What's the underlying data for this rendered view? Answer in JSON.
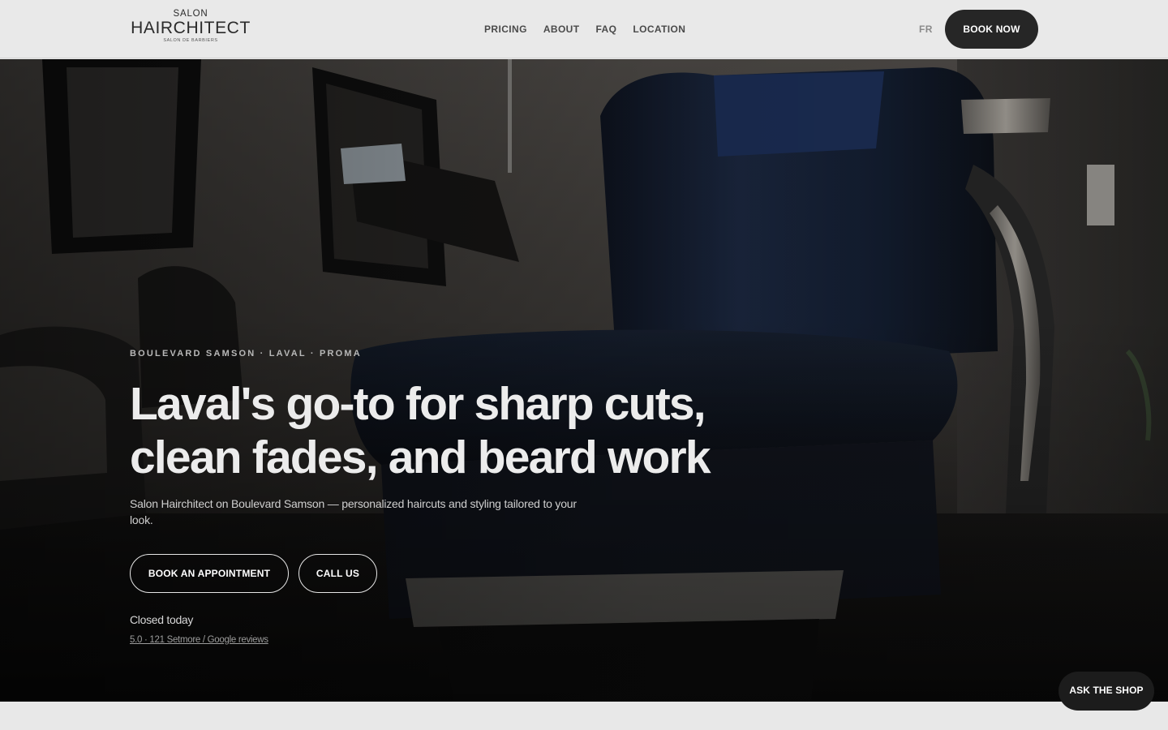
{
  "header": {
    "logo": {
      "top": "SALON",
      "main": "HAIRCHITECT",
      "sub": "SALON DE BARBIERS"
    },
    "nav": [
      {
        "label": "PRICING"
      },
      {
        "label": "ABOUT"
      },
      {
        "label": "FAQ"
      },
      {
        "label": "LOCATION"
      }
    ],
    "lang": "FR",
    "book_now": "BOOK NOW"
  },
  "hero": {
    "eyebrow": "BOULEVARD SAMSON · LAVAL · PROMA",
    "headline_line1": "Laval's go-to for sharp cuts,",
    "headline_line2": "clean fades, and beard work",
    "lead": "Salon Hairchitect on Boulevard Samson — personalized haircuts and styling tailored to your look.",
    "cta_book": "BOOK AN APPOINTMENT",
    "cta_call": "CALL US",
    "hours": "Closed today",
    "reviews": "5.0 · 121 Setmore / Google reviews"
  },
  "chat": {
    "label": "ASK THE SHOP"
  },
  "colors": {
    "header_bg": "#e9e9e9",
    "dark_button": "#262626",
    "hero_text": "#ececec",
    "chair_blue": "#1d2a44"
  }
}
